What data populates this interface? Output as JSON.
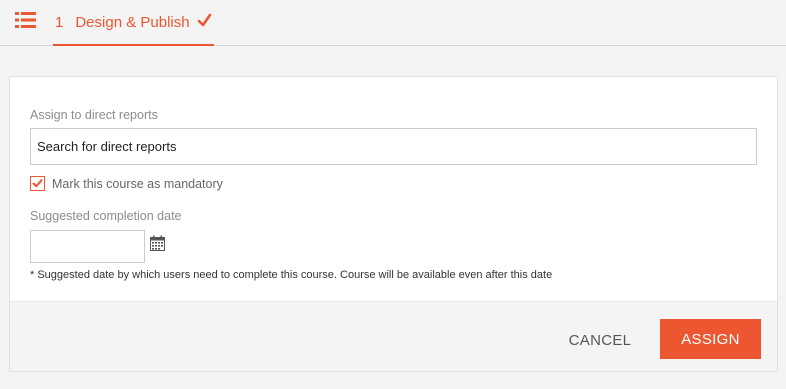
{
  "colors": {
    "accent": "#ec5630",
    "page_background": "#f4f4f4",
    "card_background": "#ffffff"
  },
  "topbar": {
    "menu_icon": "list-icon",
    "step_tab": {
      "number": "1",
      "label": "Design & Publish",
      "status_icon": "checkmark-icon"
    }
  },
  "form": {
    "assign_label": "Assign to direct reports",
    "search_value": "Search for direct reports",
    "mandatory_checked": true,
    "mandatory_label": "Mark this course as mandatory",
    "date_label": "Suggested completion date",
    "date_value": "",
    "date_icon": "calendar-icon",
    "note": "* Suggested date by which users need to complete this course. Course will be available even after this date"
  },
  "footer": {
    "cancel_label": "CANCEL",
    "assign_label": "ASSIGN"
  }
}
